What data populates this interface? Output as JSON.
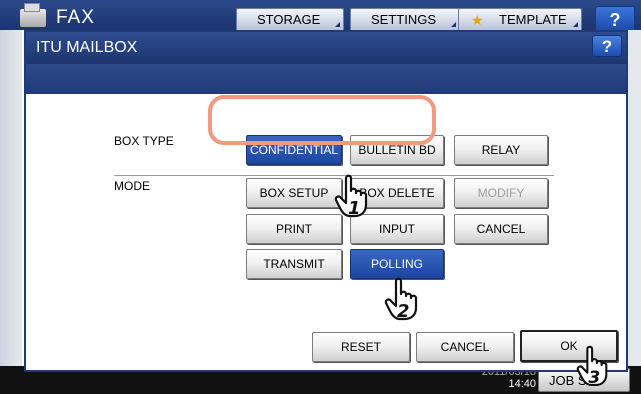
{
  "background": {
    "title": "FAX",
    "tabs": [
      "STORAGE",
      "SETTINGS",
      "TEMPLATE"
    ],
    "help_label": "?",
    "datetime": {
      "date": "2011/03/18",
      "time": "14:40"
    },
    "job_button": "JOB S"
  },
  "dialog": {
    "title": "ITU MAILBOX",
    "help_label": "?",
    "box_type": {
      "label": "BOX TYPE",
      "options": [
        "CONFIDENTIAL",
        "BULLETIN BD",
        "RELAY"
      ],
      "selected": "CONFIDENTIAL"
    },
    "mode": {
      "label": "MODE",
      "buttons": [
        "BOX SETUP",
        "BOX DELETE",
        "MODIFY",
        "PRINT",
        "INPUT",
        "CANCEL",
        "TRANSMIT",
        "POLLING"
      ],
      "selected": "POLLING",
      "disabled": [
        "MODIFY"
      ]
    },
    "footer": {
      "reset": "RESET",
      "cancel": "CANCEL",
      "ok": "OK"
    }
  },
  "annotations": {
    "step1": "1",
    "step2": "2",
    "step3": "3",
    "highlight_color": "#f29a80"
  },
  "colors": {
    "header_blue": "#1d3671",
    "selected_blue": "#1c45a0",
    "help_blue": "#1c4cad"
  }
}
